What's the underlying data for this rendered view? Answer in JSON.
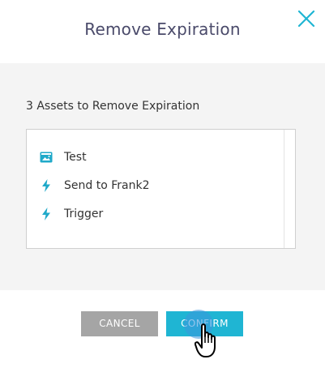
{
  "dialog": {
    "title": "Remove Expiration",
    "close_icon": "close-icon",
    "accent_color": "#1fb5d3"
  },
  "content": {
    "section_label": "3 Assets to Remove Expiration",
    "items": [
      {
        "label": "Test",
        "icon": "landing-page-icon"
      },
      {
        "label": "Send to Frank2",
        "icon": "lightning-icon"
      },
      {
        "label": "Trigger",
        "icon": "lightning-icon"
      }
    ]
  },
  "footer": {
    "cancel_label": "CANCEL",
    "confirm_label": "CONFIRM",
    "cursor_icon": "hand-pointer-icon"
  }
}
